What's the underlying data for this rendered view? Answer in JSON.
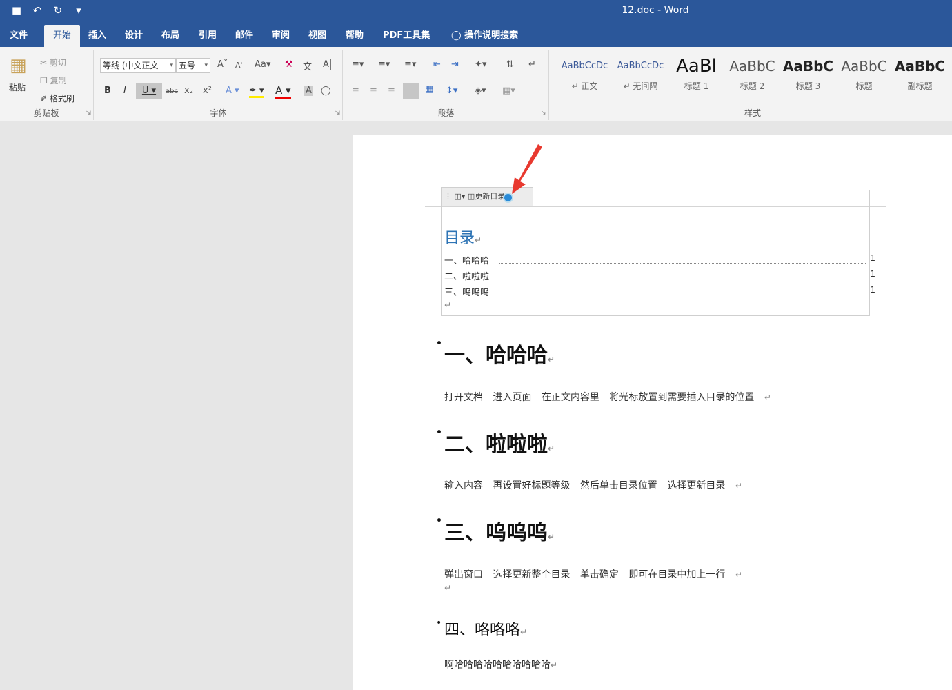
{
  "window": {
    "title": "12.doc  -  Word"
  },
  "qat": {
    "save_icon": "■",
    "undo_icon": "↶",
    "redo_icon": "↻",
    "more_icon": "▾"
  },
  "tabs": [
    "文件",
    "开始",
    "插入",
    "设计",
    "布局",
    "引用",
    "邮件",
    "审阅",
    "视图",
    "帮助",
    "PDF工具集",
    "操作说明搜索"
  ],
  "clipboard": {
    "paste": "粘贴",
    "cut": "剪切",
    "copy": "复制",
    "format_painter": "格式刷",
    "label": "剪贴板"
  },
  "font": {
    "name": "等线 (中文正文",
    "size": "五号",
    "label": "字体"
  },
  "paragraph": {
    "label": "段落"
  },
  "styles": {
    "label": "样式",
    "items": [
      {
        "preview": "AaBbCcDc",
        "name": "↵ 正文"
      },
      {
        "preview": "AaBbCcDc",
        "name": "↵ 无间隔"
      },
      {
        "preview": "AaBl",
        "name": "标题 1"
      },
      {
        "preview": "AaBbC",
        "name": "标题 2"
      },
      {
        "preview": "AaBbC",
        "name": "标题 3"
      },
      {
        "preview": "AaBbC",
        "name": "标题"
      },
      {
        "preview": "AaBbC",
        "name": "副标题"
      }
    ]
  },
  "toc": {
    "toolbar_label": "更新目录...",
    "title": "目录",
    "entries": [
      {
        "text": "一、哈哈哈",
        "page": "1"
      },
      {
        "text": "二、啦啦啦",
        "page": "1"
      },
      {
        "text": "三、呜呜呜",
        "page": "1"
      }
    ]
  },
  "doc": {
    "return_mark": "↵",
    "h1": "一、哈哈哈",
    "p1": "打开文档  进入页面  在正文内容里  将光标放置到需要插入目录的位置",
    "h2": "二、啦啦啦",
    "p2": "输入内容  再设置好标题等级  然后单击目录位置  选择更新目录",
    "h3": "三、呜呜呜",
    "p3": "弹出窗口  选择更新整个目录  单击确定  即可在目录中加上一行",
    "h4": "四、咯咯咯",
    "p4": "啊哈哈哈哈哈哈哈哈哈哈"
  }
}
